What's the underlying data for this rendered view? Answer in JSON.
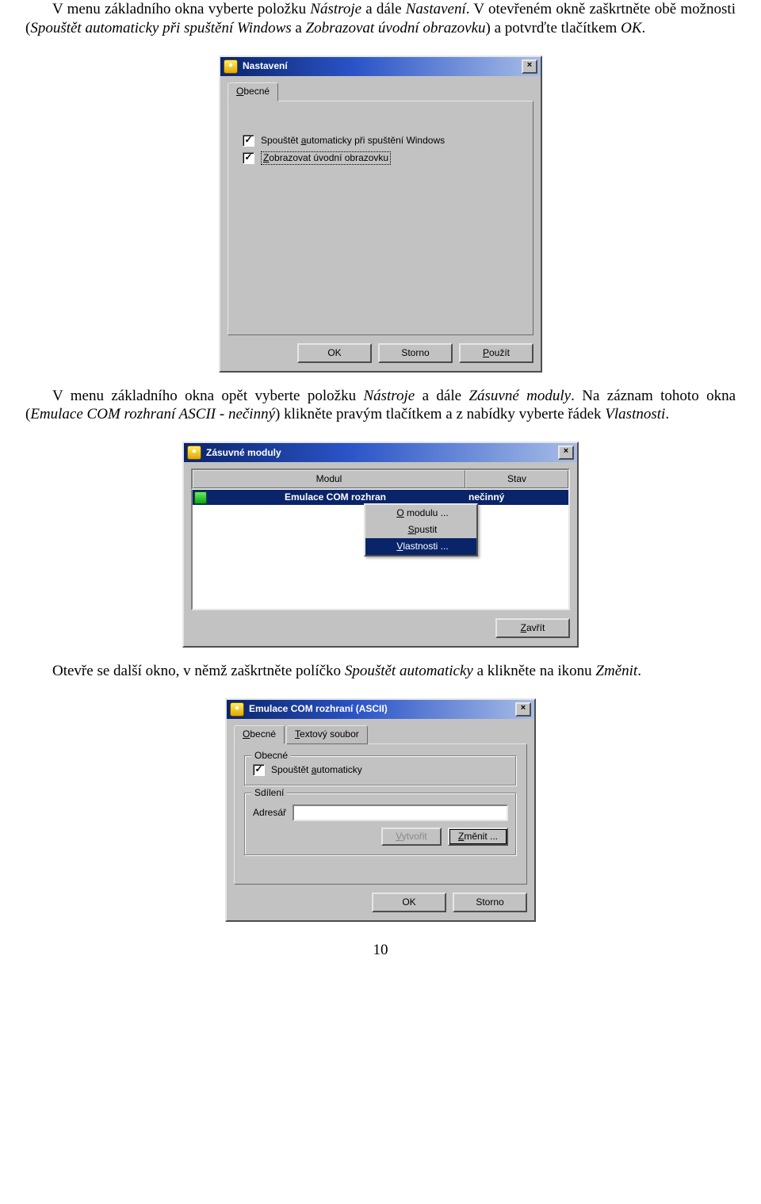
{
  "para1": {
    "pre": "V menu základního okna vyberte položku ",
    "i1": "Nástroje",
    "mid1": " a dále ",
    "i2": "Nastavení",
    "mid2": ". V otevřeném okně zaškrtněte obě možnosti (",
    "i3": "Spouštět automaticky při spuštění Windows",
    "mid3": " a ",
    "i4": "Zobrazovat úvodní obrazovku",
    "mid4": ") a potvrďte tlačítkem ",
    "i5": "OK",
    "end": "."
  },
  "dlg1": {
    "title": "Nastavení",
    "tab": "Obecné",
    "chk1": "Spouštět automaticky při spuštění Windows",
    "chk2": "Zobrazovat úvodní obrazovku",
    "ok": "OK",
    "cancel": "Storno",
    "apply": "Použít"
  },
  "para2": {
    "pre": "V menu základního okna opět vyberte položku ",
    "i1": "Nástroje",
    "mid1": " a dále ",
    "i2": "Zásuvné moduly",
    "mid2": ". Na záznam tohoto okna (",
    "i3": "Emulace COM rozhraní ASCII - nečinný",
    "mid3": ") klikněte pravým tlačítkem a z nabídky vyberte řádek ",
    "i4": "Vlastnosti",
    "end": "."
  },
  "dlg2": {
    "title": "Zásuvné moduly",
    "col1": "Modul",
    "col2": "Stav",
    "row_name": "Emulace COM rozhran",
    "row_state": "nečinný",
    "menu1": "O modulu ...",
    "menu2": "Spustit",
    "menu3": "Vlastnosti ...",
    "close": "Zavřít"
  },
  "para3": {
    "pre": "Otevře se další okno, v němž zaškrtněte políčko ",
    "i1": "Spouštět automaticky",
    "mid": " a klikněte na ikonu ",
    "i2": "Změnit",
    "end": "."
  },
  "dlg3": {
    "title": "Emulace COM rozhraní (ASCII)",
    "tab1": "Obecné",
    "tab2": "Textový soubor",
    "grp1": "Obecné",
    "chk": "Spouštět automaticky",
    "grp2": "Sdílení",
    "dir_label": "Adresář",
    "create": "Vytvořit",
    "change": "Změnit ...",
    "ok": "OK",
    "cancel": "Storno"
  },
  "page_num": "10"
}
